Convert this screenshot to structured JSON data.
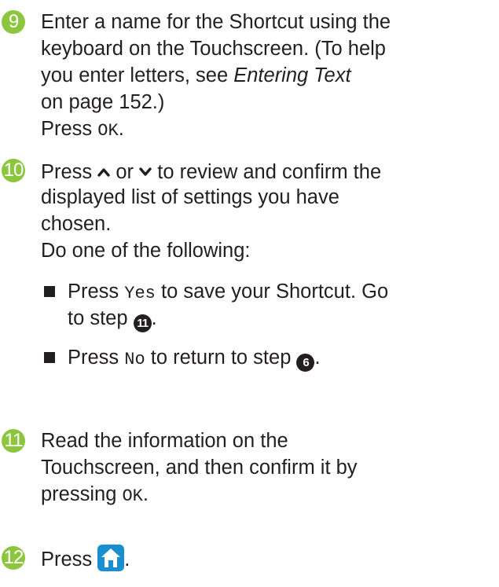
{
  "steps": [
    {
      "number": "9",
      "lines": [
        "Enter a name for the Shortcut using the",
        "keyboard on the Touchscreen. (To help",
        "you enter letters, see",
        "Entering Text",
        "on page 152.)",
        "Press",
        "OK",
        "."
      ]
    },
    {
      "number": "10",
      "press_prefix": "Press",
      "up_icon": "chevron-up-icon",
      "or_text": "or",
      "down_icon": "chevron-down-icon",
      "line1_tail": "to review and confirm the",
      "line2": "displayed list of settings you have",
      "line3": "chosen.",
      "line4": "Do one of the following:",
      "bullets": [
        {
          "press": "Press",
          "key": "Yes",
          "text": "to save your Shortcut.  Go",
          "text2": "to step",
          "ref": "11",
          "end": "."
        },
        {
          "press": "Press",
          "key": "No",
          "text": "to return to step",
          "ref": "6",
          "end": "."
        }
      ]
    },
    {
      "number": "11",
      "line1": "Read the information on the",
      "line2": "Touchscreen, and then confirm it by",
      "line3_prefix": "pressing",
      "key": "OK",
      "end": "."
    },
    {
      "number": "12",
      "press": "Press",
      "icon": "home-icon",
      "end": "."
    }
  ],
  "colors": {
    "step_number_bg": "#8cc63f",
    "home_button_bg": "#1a8fd0",
    "text": "#231f20"
  }
}
